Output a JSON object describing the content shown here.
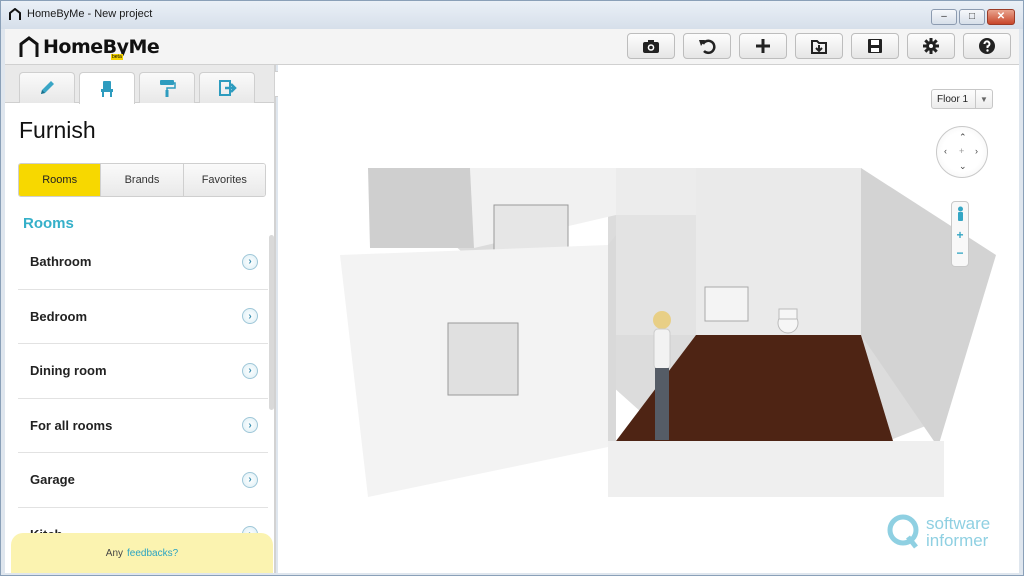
{
  "window": {
    "title": "HomeByMe - New project",
    "buttons": {
      "minimize": "–",
      "maximize": "□",
      "close": "✕"
    }
  },
  "app": {
    "logo": "HomeByMe",
    "logo_badge": "beta",
    "toolbar": [
      {
        "icon": "camera-icon"
      },
      {
        "icon": "undo-icon"
      },
      {
        "icon": "plus-icon"
      },
      {
        "icon": "import-icon"
      },
      {
        "icon": "save-icon"
      },
      {
        "icon": "gear-icon"
      },
      {
        "icon": "help-icon"
      }
    ]
  },
  "sidebar": {
    "tabs": [
      {
        "icon": "pencil-icon"
      },
      {
        "icon": "chair-icon",
        "active": true
      },
      {
        "icon": "paint-roller-icon"
      },
      {
        "icon": "export-icon"
      }
    ],
    "title": "Furnish",
    "segments": [
      "Rooms",
      "Brands",
      "Favorites"
    ],
    "active_segment": "Rooms",
    "section_title": "Rooms",
    "items": [
      {
        "label": "Bathroom"
      },
      {
        "label": "Bedroom"
      },
      {
        "label": "Dining room"
      },
      {
        "label": "For all rooms"
      },
      {
        "label": "Garage"
      },
      {
        "label": "Kitch"
      }
    ],
    "feedback_prefix": "Any",
    "feedback_link": "feedbacks?",
    "collapse_label": "◀◀"
  },
  "viewport": {
    "floor_selector": "Floor 1",
    "floor_arrow": "▼",
    "nav_arrows": {
      "up": "⌃",
      "down": "⌄",
      "left": "‹",
      "right": "›",
      "center": "+"
    },
    "zoom_plus": "+",
    "zoom_minus": "−"
  },
  "watermark": {
    "line1": "software",
    "line2": "informer"
  },
  "colors": {
    "accent_yellow": "#f7d800",
    "accent_teal": "#35b0c9",
    "floor": "#4e2414",
    "wall": "#e9e9e9"
  }
}
